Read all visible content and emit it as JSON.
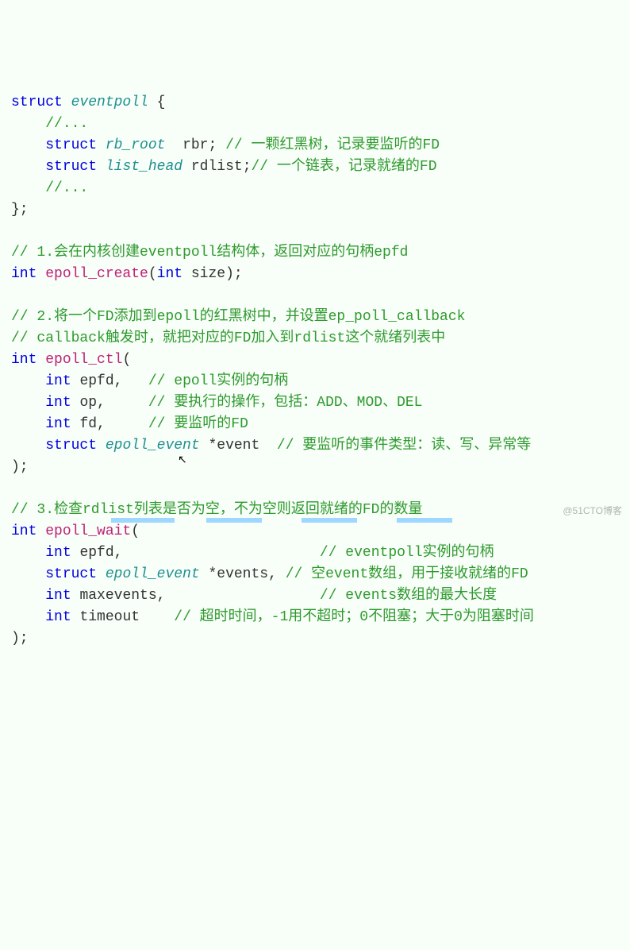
{
  "struct_kw": "struct",
  "int_kw": "int",
  "types": {
    "eventpoll": "eventpoll",
    "rb_root": "rb_root",
    "list_head": "list_head",
    "epoll_event": "epoll_event"
  },
  "fns": {
    "epoll_create": "epoll_create",
    "epoll_ctl": "epoll_ctl",
    "epoll_wait": "epoll_wait"
  },
  "ids": {
    "rbr": "rbr",
    "rdlist": "rdlist",
    "size": "size",
    "epfd": "epfd",
    "op": "op",
    "fd": "fd",
    "event": "event",
    "events": "events",
    "maxevents": "maxevents",
    "timeout": "timeout"
  },
  "comments": {
    "ellip1": "//...",
    "rbr": "// 一颗红黑树，记录要监听的FD",
    "rdlist": "// 一个链表，记录就绪的FD",
    "ellip2": "//...",
    "sec1": "// 1.会在内核创建eventpoll结构体，返回对应的句柄epfd",
    "sec2a": "// 2.将一个FD添加到epoll的红黑树中，并设置ep_poll_callback",
    "sec2b": "// callback触发时，就把对应的FD加入到rdlist这个就绪列表中",
    "epfd1": "// epoll实例的句柄",
    "op": "// 要执行的操作，包括：ADD、MOD、DEL",
    "fd": "// 要监听的FD",
    "event": "// 要监听的事件类型：读、写、异常等",
    "sec3": "// 3.检查rdlist列表是否为空，不为空则返回就绪的FD的数量",
    "epfd2": "// eventpoll实例的句柄",
    "events": "// 空event数组，用于接收就绪的FD",
    "maxevents": "// events数组的最大长度",
    "timeout": "// 超时时间，-1用不超时；0不阻塞；大于0为阻塞时间"
  },
  "watermark": "@51CTO博客",
  "chart_data": null
}
